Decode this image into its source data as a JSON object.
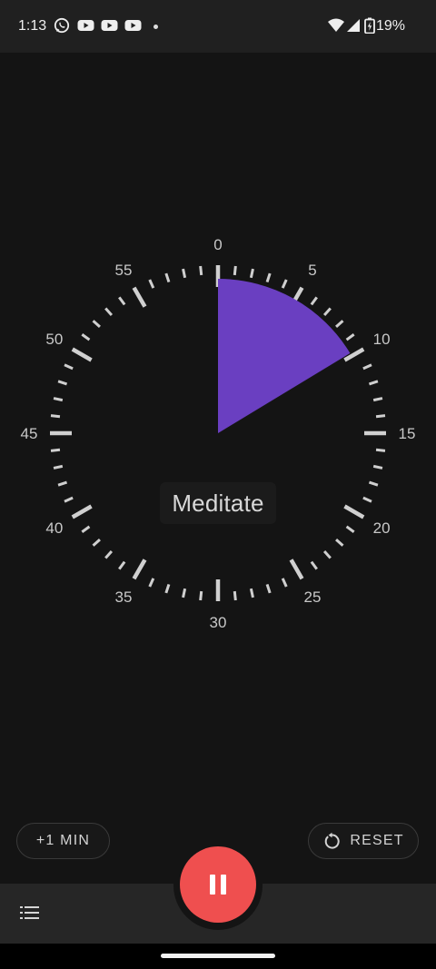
{
  "status_bar": {
    "time": "1:13",
    "battery": "19%",
    "icons": [
      "whatsapp-icon",
      "youtube-icon",
      "youtube-icon",
      "youtube-icon",
      "dot-icon",
      "wifi-icon",
      "signal-icon",
      "battery-icon"
    ]
  },
  "timer": {
    "elapsed_minutes": 9.8,
    "sector_color": "#6a3fc1",
    "minute_labels": [
      "0",
      "5",
      "10",
      "15",
      "20",
      "25",
      "30",
      "35",
      "40",
      "45",
      "50",
      "55"
    ],
    "label": "Meditate"
  },
  "controls": {
    "add_minute": "+1 MIN",
    "reset": "RESET",
    "pause_icon": "pause-icon",
    "menu_icon": "list-icon"
  },
  "colors": {
    "accent": "#ef4f4f",
    "background": "#141414",
    "bar": "#262626"
  }
}
